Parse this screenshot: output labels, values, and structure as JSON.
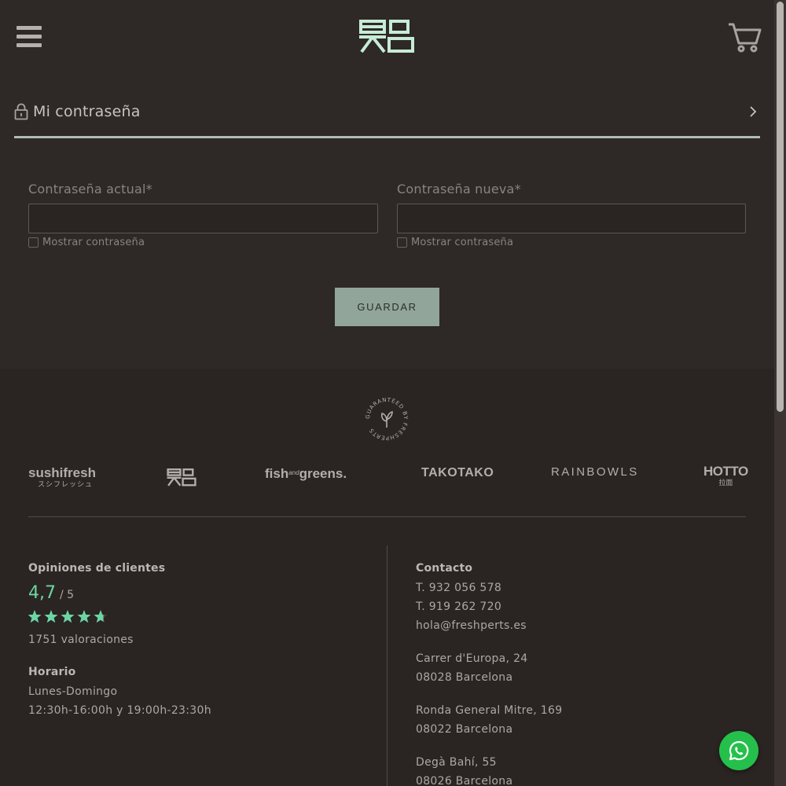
{
  "header": {
    "menu_icon": "hamburger-icon",
    "cart_icon": "cart-icon"
  },
  "section": {
    "title": "Mi contraseña",
    "icon": "lock-icon"
  },
  "form": {
    "current_label": "Contraseña actual*",
    "new_label": "Contraseña nueva*",
    "show_password": "Mostrar contraseña",
    "save_label": "GUARDAR"
  },
  "footer": {
    "badge_text": "GUARANTEED BY FRESHPERTS",
    "brands": {
      "sushifresh": "sushifresh",
      "sushifresh_jp": "スシフレッシュ",
      "fish": "fish",
      "and": "and",
      "greens": "greens.",
      "takotako": "TAKOTAKO",
      "rainbowls": "RAINBOWLS",
      "hotto": "HOTTO",
      "hotto_jp": "拉面"
    },
    "reviews": {
      "title": "Opiniones de clientes",
      "score": "4,7",
      "scale": "/ 5",
      "stars": 4.7,
      "count": "1751 valoraciones"
    },
    "schedule": {
      "title": "Horario",
      "days": "Lunes-Domingo",
      "hours": "12:30h-16:00h y 19:00h-23:30h"
    },
    "contact": {
      "title": "Contacto",
      "phone1": "T. 932 056 578",
      "phone2": "T. 919 262 720",
      "email": "hola@freshperts.es",
      "addr1_street": "Carrer d'Europa, 24",
      "addr1_city": "08028 Barcelona",
      "addr2_street": "Ronda General Mitre, 169",
      "addr2_city": "08022 Barcelona",
      "addr3_street": "Degà Bahí, 55",
      "addr3_city": "08026 Barcelona"
    }
  },
  "colors": {
    "background": "#2e2826",
    "accent": "#aebdb5",
    "logo": "#c6ecd6",
    "rating": "#6cd6a3",
    "whatsapp": "#25c04b"
  }
}
